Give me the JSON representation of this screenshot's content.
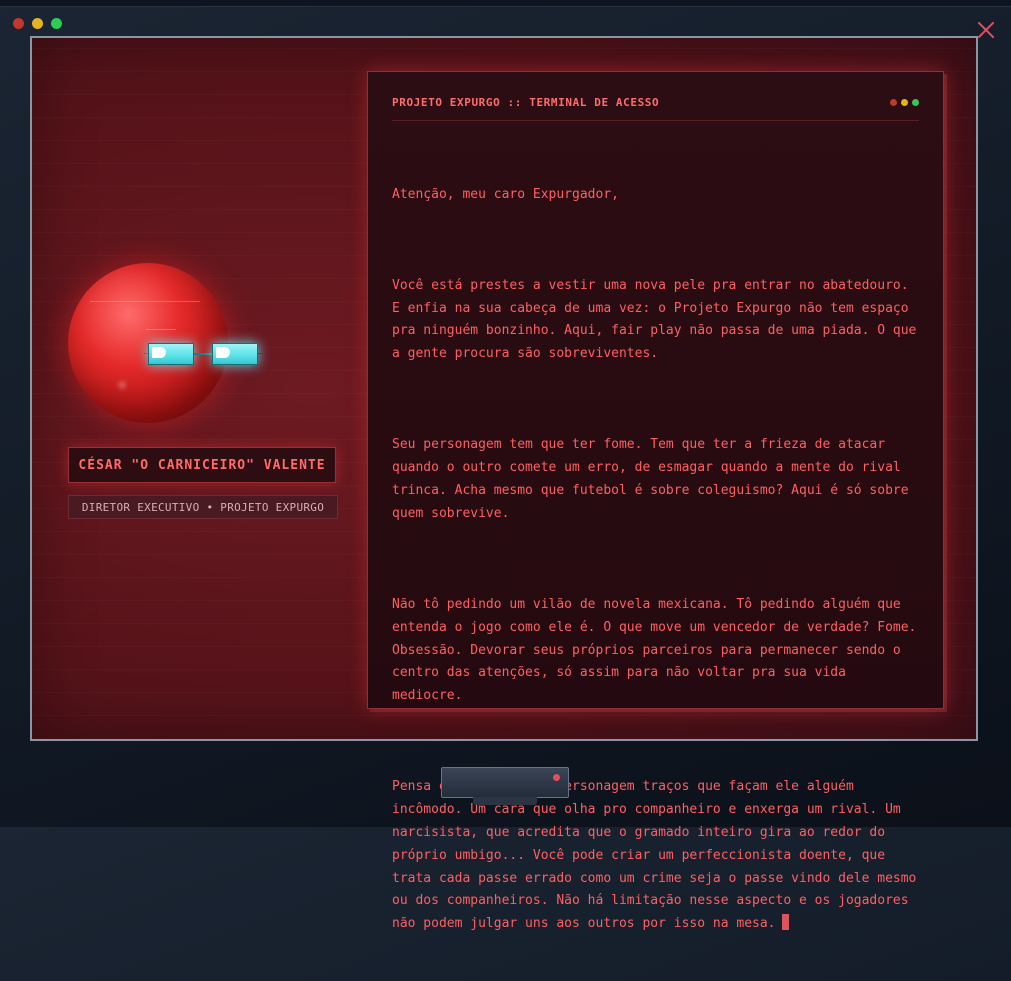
{
  "window": {
    "traffic_lights": [
      "close",
      "minimize",
      "maximize"
    ],
    "close_icon": "close-x-icon"
  },
  "profile": {
    "avatar_icon": "red-orb-with-cyan-glasses",
    "name": "CÉSAR \"O CARNICEIRO\" VALENTE",
    "role": "DIRETOR EXECUTIVO • PROJETO EXPURGO"
  },
  "terminal": {
    "title": "PROJETO EXPURGO :: TERMINAL DE ACESSO",
    "paragraphs": [
      "Atenção, meu caro Expurgador,",
      "Você está prestes a vestir uma nova pele pra entrar no abatedouro. E enfia na sua cabeça de uma vez: o Projeto Expurgo não tem espaço pra ninguém bonzinho. Aqui, fair play não passa de uma piada. O que a gente procura são sobreviventes.",
      "Seu personagem tem que ter fome. Tem que ter a frieza de atacar quando o outro comete um erro, de esmagar quando a mente do rival trinca. Acha mesmo que futebol é sobre coleguismo? Aqui é só sobre quem sobrevive.",
      "Não tô pedindo um vilão de novela mexicana. Tô pedindo alguém que entenda o jogo como ele é. O que move um vencedor de verdade? Fome. Obsessão. Devorar seus próprios parceiros para permanecer sendo o centro das atenções, só assim para não voltar pra sua vida mediocre.",
      "Pensa em dar pro seu personagem traços que façam ele alguém incômodo. Um cara que olha pro companheiro e enxerga um rival. Um narcisista, que acredita que o gramado inteiro gira ao redor do próprio umbigo... Você pode criar um perfeccionista doente, que trata cada passe errado como um crime seja o passe vindo dele mesmo ou dos companheiros. Não há limitação nesse aspecto e os jogadores não podem julgar uns aos outros por isso na mesa."
    ]
  },
  "colors": {
    "accent": "#ff5f63",
    "screen_bg": "#561319",
    "glasses": "#5fe3ea"
  }
}
